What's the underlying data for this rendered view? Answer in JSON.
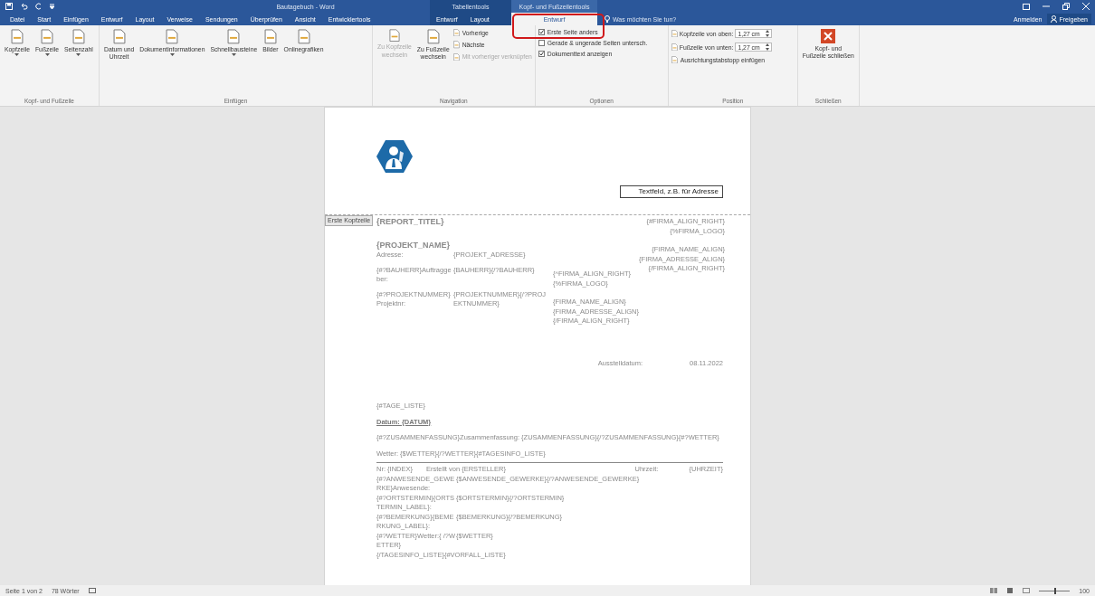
{
  "title_bar": {
    "title": "Bautagebuch - Word",
    "context_labels": [
      "Tabellentools",
      "Kopf- und Fußzeilentools"
    ]
  },
  "tabs": [
    {
      "label": "Datei",
      "selected": false
    },
    {
      "label": "Start",
      "selected": false
    },
    {
      "label": "Einfügen",
      "selected": false
    },
    {
      "label": "Entwurf",
      "selected": false
    },
    {
      "label": "Layout",
      "selected": false
    },
    {
      "label": "Verweise",
      "selected": false
    },
    {
      "label": "Sendungen",
      "selected": false
    },
    {
      "label": "Überprüfen",
      "selected": false
    },
    {
      "label": "Ansicht",
      "selected": false
    },
    {
      "label": "Entwicklertools",
      "selected": false
    },
    {
      "label": "Entwurf",
      "selected": false
    },
    {
      "label": "Layout",
      "selected": false
    },
    {
      "label": "Entwurf",
      "selected": true
    }
  ],
  "tell_me": "Was möchten Sie tun?",
  "account": "Anmelden",
  "share": "Freigeben",
  "ribbon": {
    "groups": [
      {
        "label": "Kopf- und Fußzeile",
        "items": [
          {
            "kind": "large",
            "label": "Kopfzeile",
            "dropdown": true,
            "disabled": false
          },
          {
            "kind": "large",
            "label": "Fußzeile",
            "dropdown": true,
            "disabled": false
          },
          {
            "kind": "large",
            "label": "Seitenzahl",
            "dropdown": true,
            "disabled": false
          }
        ]
      },
      {
        "label": "Einfügen",
        "items": [
          {
            "kind": "large",
            "label": "Datum und\nUhrzeit",
            "dropdown": false,
            "disabled": false
          },
          {
            "kind": "large",
            "label": "Dokumentinformationen",
            "dropdown": true,
            "disabled": false
          },
          {
            "kind": "large",
            "label": "Schnellbausteine",
            "dropdown": true,
            "disabled": false
          },
          {
            "kind": "large",
            "label": "Bilder",
            "dropdown": false,
            "disabled": false
          },
          {
            "kind": "large",
            "label": "Onlinegrafiken",
            "dropdown": false,
            "disabled": false
          }
        ]
      },
      {
        "label": "Navigation",
        "items": [
          {
            "kind": "large",
            "label": "Zu Kopfzeile\nwechseln",
            "dropdown": false,
            "disabled": true
          },
          {
            "kind": "large",
            "label": "Zu Fußzeile\nwechseln",
            "dropdown": false,
            "disabled": false
          },
          {
            "kind": "small",
            "label": "Vorherige",
            "disabled": false
          },
          {
            "kind": "small",
            "label": "Nächste",
            "disabled": false
          },
          {
            "kind": "small",
            "label": "Mit vorheriger verknüpfen",
            "disabled": true
          }
        ]
      },
      {
        "label": "Optionen",
        "items": [
          {
            "kind": "checkbox",
            "label": "Erste Seite anders",
            "checked": true
          },
          {
            "kind": "checkbox",
            "label": "Gerade & ungerade Seiten untersch.",
            "checked": false
          },
          {
            "kind": "checkbox",
            "label": "Dokumenttext anzeigen",
            "checked": true
          }
        ]
      },
      {
        "label": "Position",
        "items": [
          {
            "kind": "spin",
            "label": "Kopfzeile von oben:",
            "value": "1,27 cm"
          },
          {
            "kind": "spin",
            "label": "Fußzeile von unten:",
            "value": "1,27 cm"
          },
          {
            "kind": "small",
            "label": "Ausrichtungstabstopp einfügen",
            "disabled": false
          }
        ]
      },
      {
        "label": "Schließen",
        "items": [
          {
            "kind": "close",
            "label": "Kopf- und\nFußzeile schließen",
            "dropdown": false,
            "disabled": false
          }
        ]
      }
    ]
  },
  "document": {
    "header": {
      "textbox": "Textfeld, z.B. für Adresse",
      "tag": "Erste Kopfzeile"
    },
    "title": "{REPORT_TITEL}",
    "right_block": [
      [
        "{#FIRMA_ALIGN_RIGHT}",
        "{%FIRMA_LOGO}"
      ],
      [
        "{FIRMA_NAME_ALIGN}",
        "{FIRMA_ADRESSE_ALIGN}",
        "{/FIRMA_ALIGN_RIGHT}"
      ]
    ],
    "project_name": "{PROJEKT_NAME}",
    "project_fields": [
      {
        "label": "Adresse:",
        "value": "{PROJEKT_ADRESSE}"
      },
      {
        "label": "{#?BAUHERR}Auftraggeber:",
        "value": "{BAUHERR}{/?BAUHERR}"
      },
      {
        "label": "{#?PROJEKTNUMMER}Projektnr:",
        "value": "{PROJEKTNUMMER}{/?PROJEKTNUMMER}"
      }
    ],
    "middle_block": [
      [
        "{^FIRMA_ALIGN_RIGHT}",
        "{%FIRMA_LOGO}"
      ],
      [
        "{FIRMA_NAME_ALIGN}",
        "{FIRMA_ADRESSE_ALIGN}",
        "{/FIRMA_ALIGN_RIGHT}"
      ]
    ],
    "issue_date": {
      "label": "Ausstelldatum:",
      "value": "08.11.2022"
    },
    "body": [
      {
        "kind": "text",
        "text": "{#TAGE_LISTE}"
      },
      {
        "kind": "heading",
        "text": "Datum: {DATUM}"
      },
      {
        "kind": "text",
        "text": "{#?ZUSAMMENFASSUNG}Zusammenfassung: {ZUSAMMENFASSUNG}{/?ZUSAMMENFASSUNG}{#?WETTER}"
      },
      {
        "kind": "text",
        "text": "Wetter: {$WETTER}{/?WETTER}{#TAGESINFO_LISTE}"
      }
    ],
    "entry_header": [
      "Nr: {INDEX}",
      "Erstellt von {ERSTELLER}",
      "Uhrzeit:",
      "{UHRZEIT}"
    ],
    "entry_rows": [
      {
        "label": "{#?ANWESENDE_GEWERKE}Anwesende:",
        "value": "{$ANWESENDE_GEWERKE}{/?ANWESENDE_GEWERKE}"
      },
      {
        "label": "{#?ORTSTERMIN}{ORTSTERMIN_LABEL}:",
        "value": "{$ORTSTERMIN}{/?ORTSTERMIN}"
      },
      {
        "label": "{#?BEMERKUNG}{BEMERKUNG_LABEL}:",
        "value": "{$BEMERKUNG}{/?BEMERKUNG}"
      },
      {
        "label": "{#?WETTER}Wetter:{ /?WETTER}",
        "value": "{$WETTER}"
      }
    ],
    "closing": "{/TAGESINFO_LISTE}{#VORFALL_LISTE}"
  },
  "status_bar": {
    "page": "Seite 1 von 2",
    "words": "78 Wörter",
    "zoom": {
      "level": 0.5
    },
    "zoom_text": "100"
  }
}
